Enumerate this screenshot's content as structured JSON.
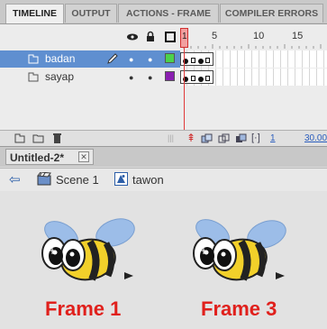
{
  "tabs": [
    {
      "label": "TIMELINE",
      "active": true
    },
    {
      "label": "OUTPUT",
      "active": false
    },
    {
      "label": "ACTIONS - FRAME",
      "active": false
    },
    {
      "label": "COMPILER ERRORS",
      "active": false
    }
  ],
  "timeline": {
    "ruler": [
      "1",
      "5",
      "10",
      "15"
    ],
    "current_frame": "1",
    "layers": [
      {
        "name": "badan",
        "selected": true,
        "color": "#4cd24c"
      },
      {
        "name": "sayap",
        "selected": false,
        "color": "#8a1fb0"
      }
    ],
    "status_frame": "1",
    "fps": "30.00"
  },
  "document": {
    "tab_title": "Untitled-2*",
    "breadcrumb_scene": "Scene 1",
    "breadcrumb_symbol": "tawon"
  },
  "stage": {
    "labels": [
      "Frame 1",
      "Frame 3"
    ]
  },
  "colors": {
    "selection": "#5f8fd0",
    "playhead": "#e03a3a",
    "label_red": "#e0201c"
  }
}
